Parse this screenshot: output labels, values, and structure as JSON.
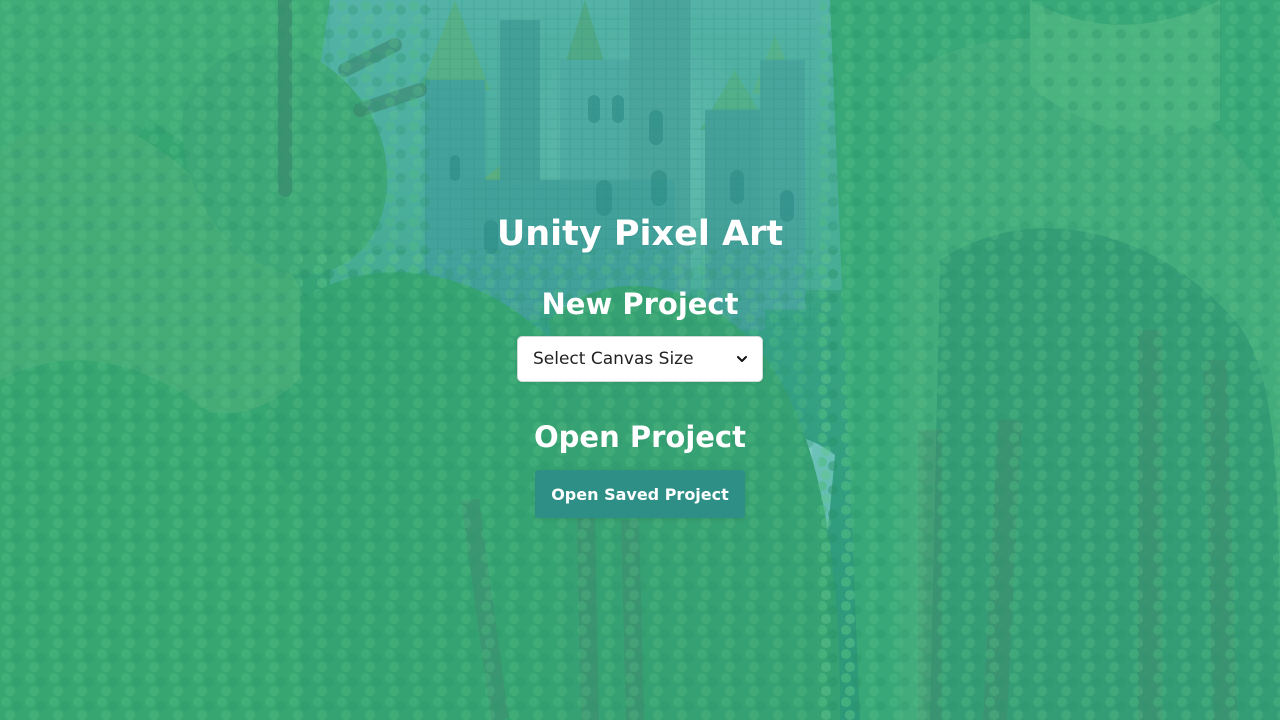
{
  "app": {
    "title": "Unity Pixel Art"
  },
  "new_project": {
    "heading": "New Project",
    "canvas_size_select": {
      "selected_value": "Select Canvas Size",
      "icon": "chevron-down-icon"
    }
  },
  "open_project": {
    "heading": "Open Project",
    "button_label": "Open Saved Project"
  },
  "colors": {
    "text": "#FFFFFF",
    "button": "#2E8F86",
    "select_background": "#FFFFFF",
    "select_text": "#222222",
    "background_green": "#35A47F",
    "background_teal": "#5CB8AD"
  },
  "background": {
    "type": "pixel-art fantasy forest with castle and waterfall"
  }
}
